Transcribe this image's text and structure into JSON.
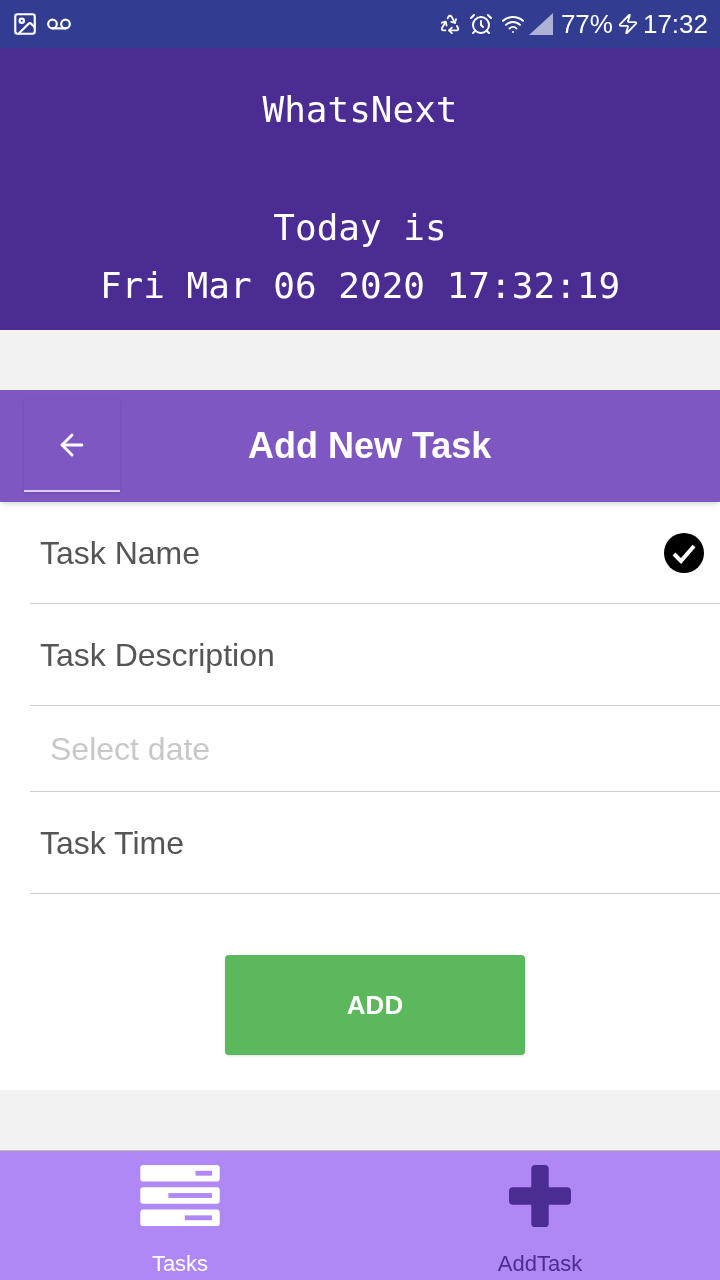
{
  "status_bar": {
    "battery": "77%",
    "time": "17:32"
  },
  "header": {
    "title": "WhatsNext",
    "line_1": "Today is",
    "line_2": "Fri Mar 06 2020 17:32:19"
  },
  "toolbar": {
    "title": "Add New Task"
  },
  "fields": [
    {
      "kind": "text",
      "placeholder": "Task Name",
      "valid": true
    },
    {
      "kind": "text",
      "placeholder": "Task Description",
      "valid": false
    },
    {
      "kind": "date",
      "placeholder": "Select date",
      "valid": false
    },
    {
      "kind": "text",
      "placeholder": "Task Time",
      "valid": false
    }
  ],
  "add_button": "ADD",
  "bottom_nav": [
    {
      "label": "Tasks",
      "kind": "list",
      "selected": false
    },
    {
      "label": "AddTask",
      "kind": "plus",
      "selected": true
    }
  ]
}
